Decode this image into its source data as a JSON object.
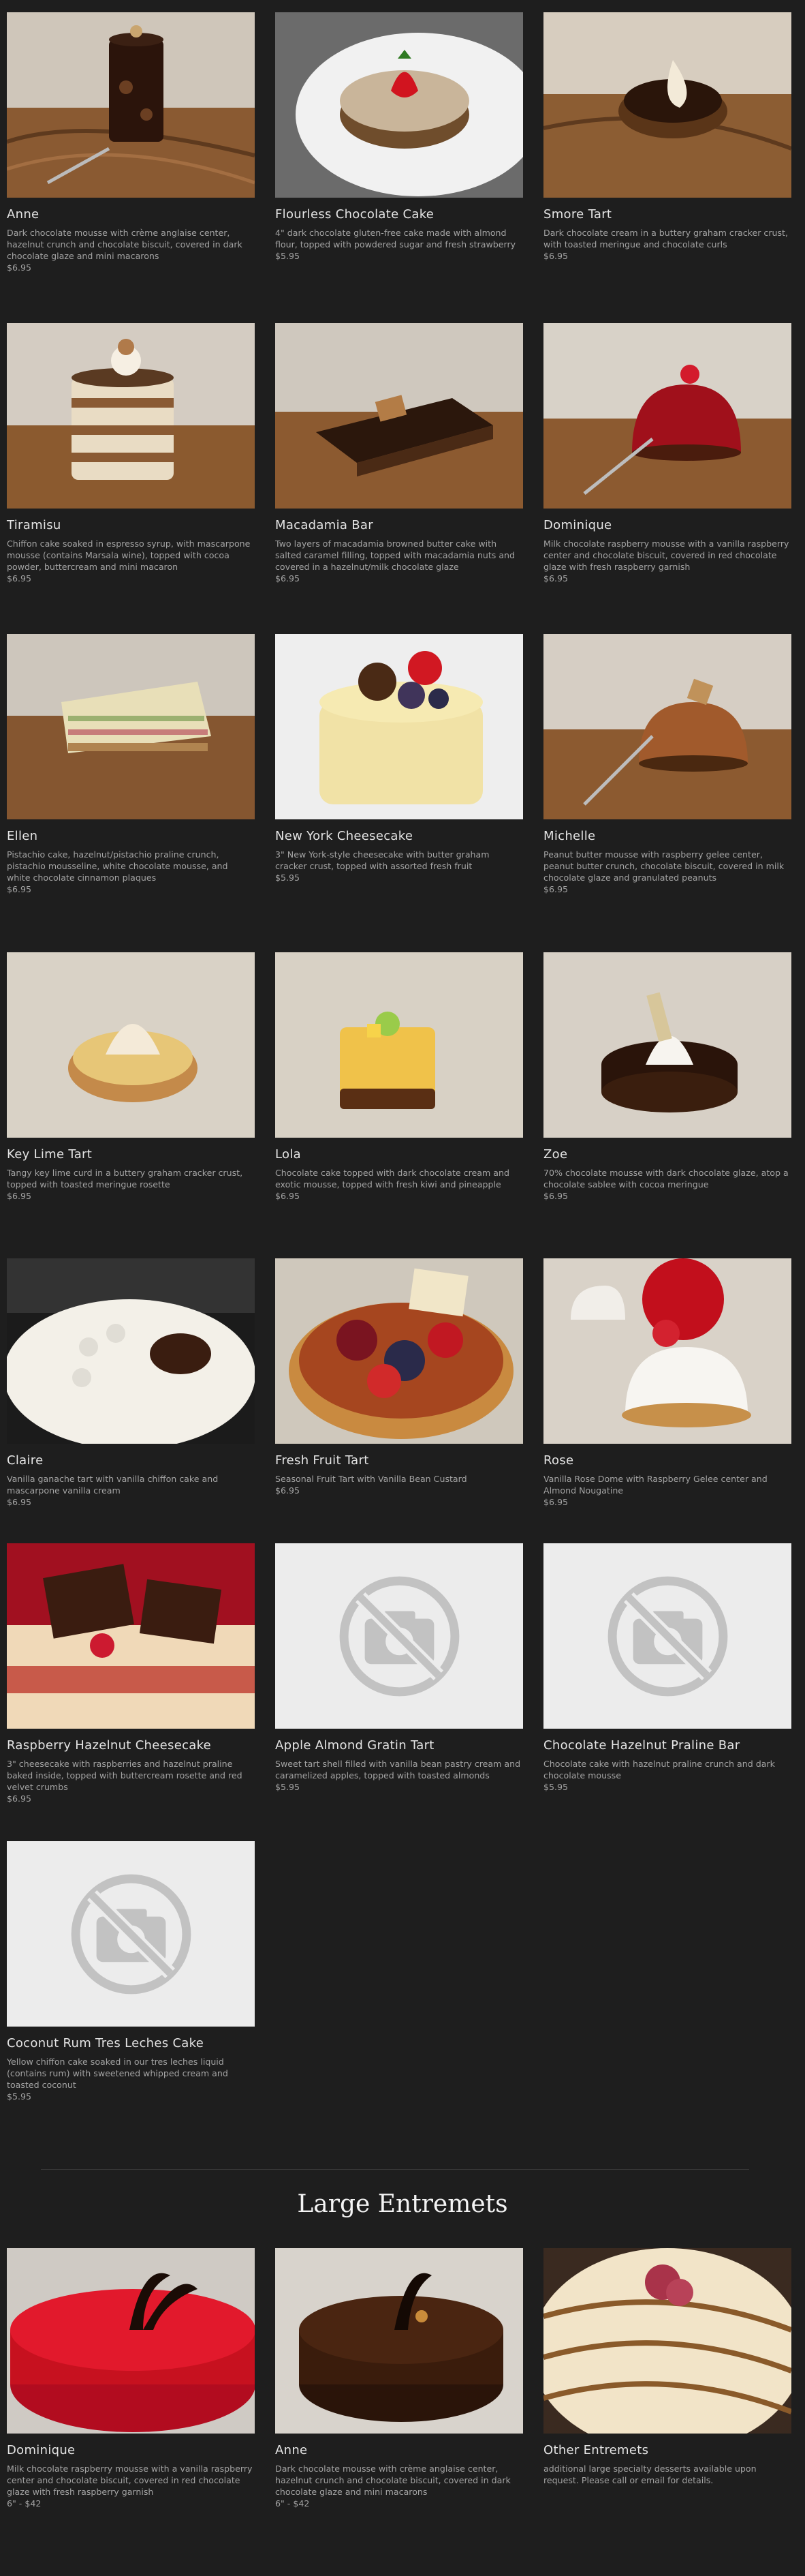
{
  "menu": [
    {
      "name": "Anne",
      "desc": "Dark chocolate mousse with crème anglaise center, hazelnut crunch and chocolate biscuit, covered in dark chocolate glaze and mini macarons",
      "price": "$6.95",
      "photo": "anne"
    },
    {
      "name": "Flourless Chocolate Cake",
      "desc": "4\" dark chocolate gluten-free cake made with almond flour, topped with powdered sugar and fresh strawberry",
      "price": "$5.95",
      "photo": "flourless"
    },
    {
      "name": "Smore Tart",
      "desc": "Dark chocolate cream in a buttery graham cracker crust, with toasted meringue and chocolate curls",
      "price": "$6.95",
      "photo": "smore"
    },
    {
      "name": "Tiramisu",
      "desc": "Chiffon cake soaked in espresso syrup, with mascarpone mousse (contains Marsala wine), topped with cocoa powder, buttercream and mini macaron",
      "price": "$6.95",
      "photo": "tiramisu"
    },
    {
      "name": "Macadamia Bar",
      "desc": "Two layers of macadamia browned butter cake with salted caramel filling, topped with macadamia nuts and covered in a hazelnut/milk chocolate glaze",
      "price": "$6.95",
      "photo": "macadamia"
    },
    {
      "name": "Dominique",
      "desc": "Milk chocolate raspberry mousse with a vanilla raspberry center and chocolate biscuit, covered in red chocolate glaze with fresh raspberry garnish",
      "price": "$6.95",
      "photo": "dominique"
    },
    {
      "name": "Ellen",
      "desc": "Pistachio cake, hazelnut/pistachio praline crunch, pistachio mousseline, white chocolate mousse, and white chocolate cinnamon plaques",
      "price": "$6.95",
      "photo": "ellen"
    },
    {
      "name": "New York Cheesecake",
      "desc": "3\" New York-style cheesecake with butter graham cracker crust, topped with assorted fresh fruit",
      "price": "$5.95",
      "photo": "nycheese"
    },
    {
      "name": "Michelle",
      "desc": "Peanut butter mousse with raspberry gelee center, peanut butter crunch, chocolate biscuit, covered in milk chocolate glaze and granulated peanuts",
      "price": "$6.95",
      "photo": "michelle"
    },
    {
      "name": "Key Lime Tart",
      "desc": "Tangy key lime curd in a buttery graham cracker crust, topped with toasted meringue rosette",
      "price": "$6.95",
      "photo": "keylime"
    },
    {
      "name": "Lola",
      "desc": "Chocolate cake topped with dark chocolate cream and exotic mousse, topped with fresh kiwi and pineapple",
      "price": "$6.95",
      "photo": "lola"
    },
    {
      "name": "Zoe",
      "desc": "70% chocolate mousse with dark chocolate glaze, atop a chocolate sablee with cocoa meringue",
      "price": "$6.95",
      "photo": "zoe"
    },
    {
      "name": "Claire",
      "desc": "Vanilla ganache tart with vanilla chiffon cake and mascarpone vanilla cream",
      "price": "$6.95",
      "photo": "claire"
    },
    {
      "name": "Fresh Fruit Tart",
      "desc": "Seasonal Fruit Tart with Vanilla Bean Custard",
      "price": "$6.95",
      "photo": "fruittart"
    },
    {
      "name": "Rose",
      "desc": "Vanilla Rose Dome with Raspberry Gelee center and Almond Nougatine",
      "price": "$6.95",
      "photo": "rose"
    },
    {
      "name": "Raspberry Hazelnut Cheesecake",
      "desc": "3\" cheesecake with raspberries and hazelnut praline baked inside, topped with buttercream rosette and red velvet crumbs",
      "price": "$6.95",
      "photo": "rhcheese"
    },
    {
      "name": "Apple Almond Gratin Tart",
      "desc": "Sweet tart shell filled with vanilla bean pastry cream and caramelized apples, topped with toasted almonds",
      "price": "$5.95",
      "photo": "placeholder"
    },
    {
      "name": "Chocolate Hazelnut Praline Bar",
      "desc": "Chocolate cake with hazelnut praline crunch and dark chocolate mousse",
      "price": "$5.95",
      "photo": "placeholder"
    },
    {
      "name": "Coconut Rum Tres Leches Cake",
      "desc": "Yellow chiffon cake soaked in our tres leches liquid (contains rum) with sweetened whipped cream and toasted coconut",
      "price": "$5.95",
      "photo": "placeholder"
    }
  ],
  "large_section_title": "Large Entremets",
  "large": [
    {
      "name": "Dominique",
      "desc": "Milk chocolate raspberry mousse with a vanilla raspberry center and chocolate biscuit, covered in red chocolate glaze with fresh raspberry garnish",
      "price": "6\" - $42",
      "photo": "ldominique"
    },
    {
      "name": "Anne",
      "desc": "Dark chocolate mousse with crème anglaise center, hazelnut crunch and chocolate biscuit, covered in dark chocolate glaze and mini macarons",
      "price": "6\" - $42",
      "photo": "lanne"
    },
    {
      "name": "Other Entremets",
      "desc": "additional large specialty desserts available upon request. Please call or email for details.",
      "price": "",
      "photo": "lother"
    }
  ],
  "watermark": "sirved",
  "colors": {
    "background": "#1e1e1e",
    "name": "#e4e4e4",
    "desc": "#a3a3a3",
    "placeholder_bg": "#ececec",
    "placeholder_icon": "#c2c2c2"
  }
}
